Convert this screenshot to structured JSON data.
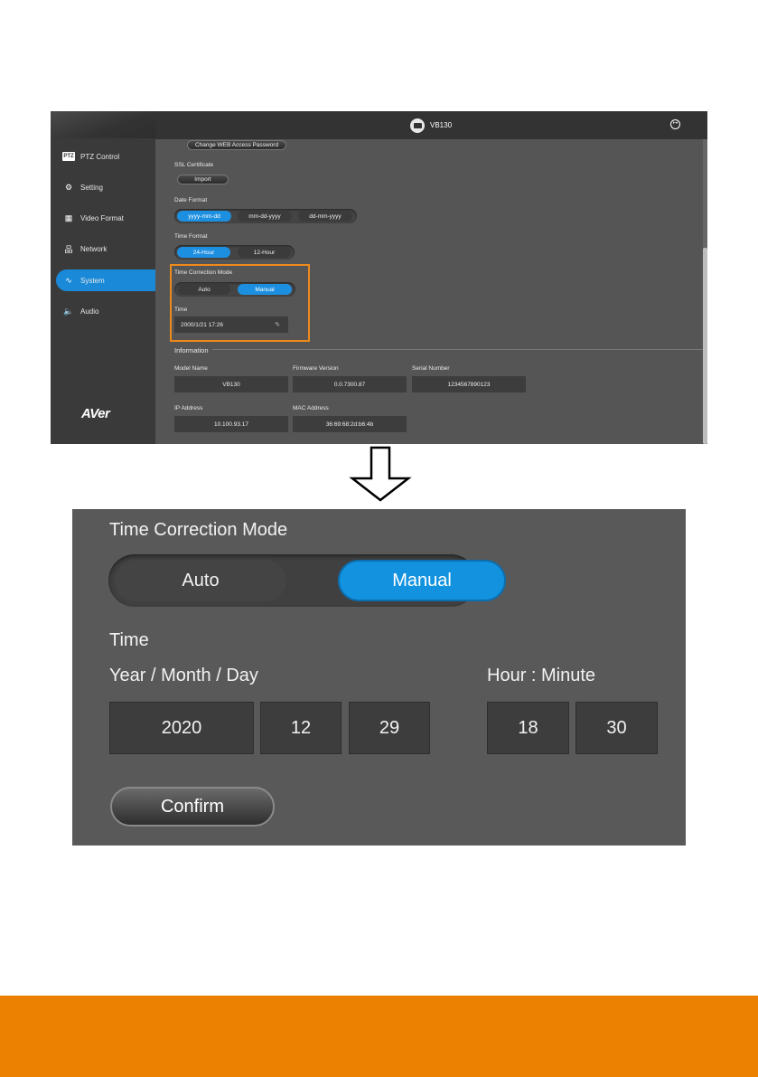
{
  "app": {
    "model": "VB130",
    "logo": "AVer"
  },
  "sidebar": {
    "items": [
      {
        "label": "PTZ Control",
        "icon": "ptz-icon",
        "badge": "PTZ"
      },
      {
        "label": "Setting",
        "icon": "gear-icon"
      },
      {
        "label": "Video Format",
        "icon": "film-icon"
      },
      {
        "label": "Network",
        "icon": "network-icon"
      },
      {
        "label": "System",
        "icon": "pulse-icon",
        "active": true
      },
      {
        "label": "Audio",
        "icon": "speaker-icon"
      }
    ]
  },
  "system": {
    "change_password_label": "Change WEB Access Password",
    "ssl_label": "SSL Certificate",
    "import_label": "Import",
    "date_format": {
      "label": "Date Format",
      "options": [
        "yyyy-mm-dd",
        "mm-dd-yyyy",
        "dd-mm-yyyy"
      ],
      "selected": "yyyy-mm-dd"
    },
    "time_format": {
      "label": "Time Format",
      "options": [
        "24-Hour",
        "12-Hour"
      ],
      "selected": "24-Hour"
    },
    "time_correction": {
      "label": "Time Correction Mode",
      "options": [
        "Auto",
        "Manual"
      ],
      "selected": "Manual"
    },
    "time": {
      "label": "Time",
      "value": "2000/1/21 17:26"
    },
    "information": {
      "label": "Information",
      "model_name_label": "Model Name",
      "model_name": "VB130",
      "firmware_label": "Firmware Version",
      "firmware": "0.0.7300.87",
      "serial_label": "Serial Number",
      "serial": "1234567890123",
      "ip_label": "IP Address",
      "ip": "10.100.93.17",
      "mac_label": "MAC Address",
      "mac": "36:69:68:2d:b6:4b"
    }
  },
  "zoom": {
    "title": "Time Correction Mode",
    "auto_label": "Auto",
    "manual_label": "Manual",
    "time_label": "Time",
    "date_label": "Year / Month / Day",
    "clock_label": "Hour : Minute",
    "year": "2020",
    "month": "12",
    "day": "29",
    "hour": "18",
    "minute": "30",
    "confirm_label": "Confirm"
  },
  "colors": {
    "accent": "#1d8fe0",
    "highlight": "#ec8a1c",
    "footer": "#ec8000"
  }
}
